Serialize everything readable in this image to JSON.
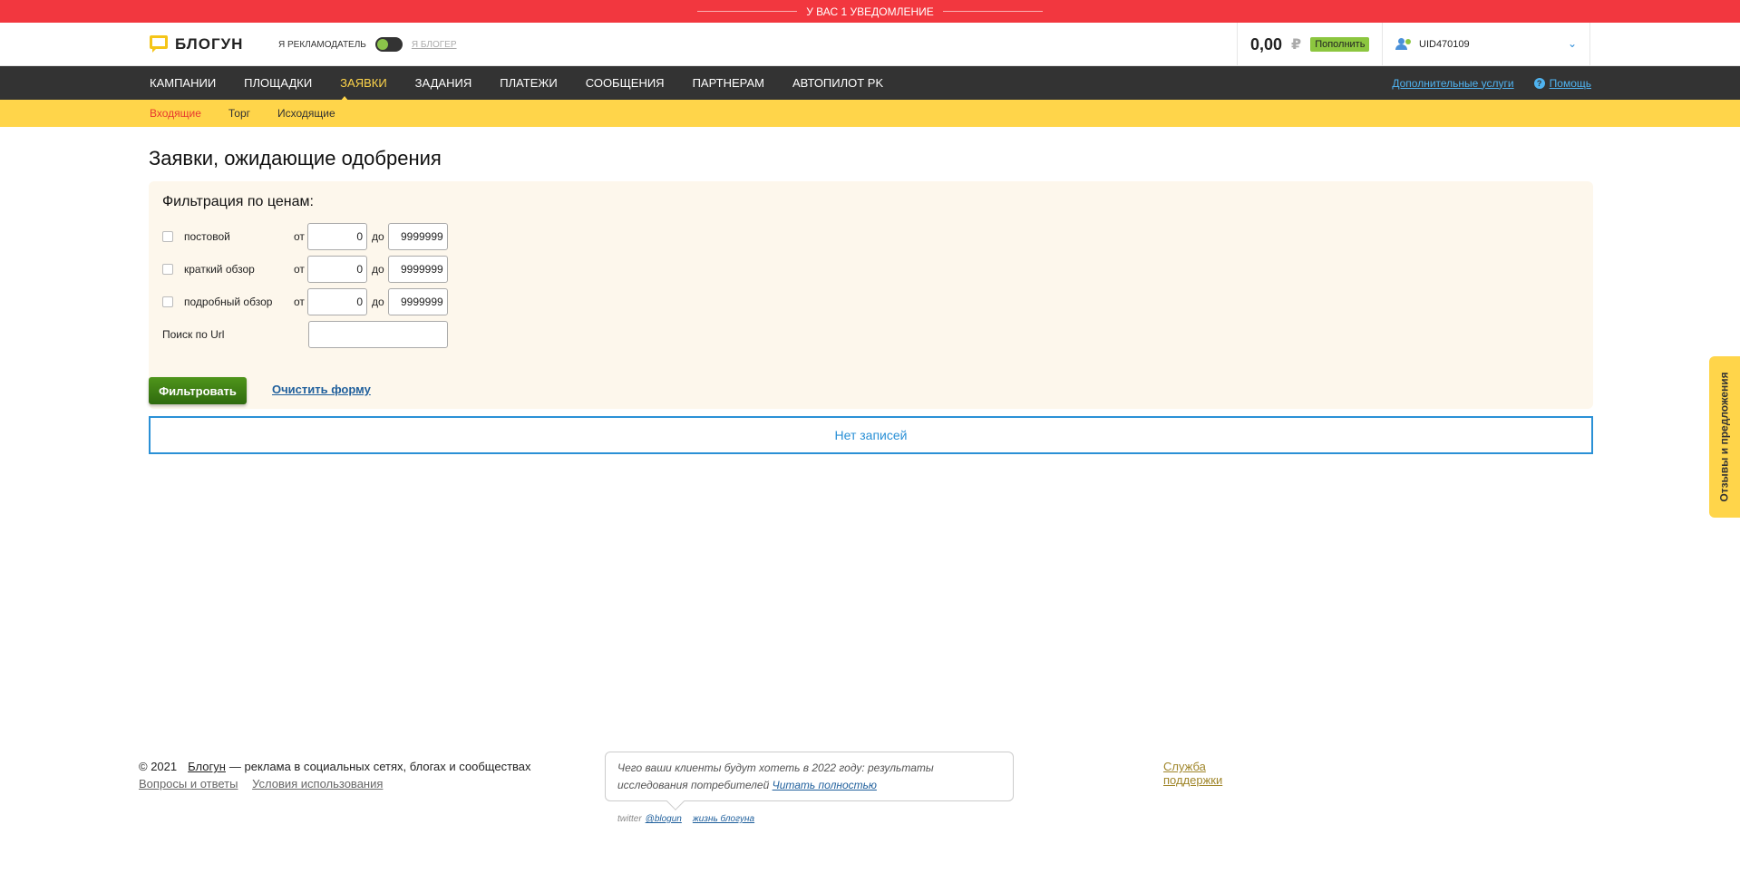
{
  "notification": {
    "text": "У ВАС 1 УВЕДОМЛЕНИЕ"
  },
  "header": {
    "logo_text": "БЛОГУН",
    "role_advertiser": "Я РЕКЛАМОДАТЕЛЬ",
    "role_blogger": "Я БЛОГЕР",
    "balance": "0,00",
    "currency": "₽",
    "topup_label": "Пополнить",
    "user_id": "UID470109"
  },
  "main_nav": {
    "items": [
      {
        "label": "КАМПАНИИ"
      },
      {
        "label": "ПЛОЩАДКИ"
      },
      {
        "label": "ЗАЯВКИ",
        "active": true
      },
      {
        "label": "ЗАДАНИЯ"
      },
      {
        "label": "ПЛАТЕЖИ"
      },
      {
        "label": "СООБЩЕНИЯ"
      },
      {
        "label": "ПАРТНЕРАМ"
      },
      {
        "label": "АВТОПИЛОТ PK"
      }
    ],
    "extra_services": "Дополнительные услуги",
    "help": "Помощь"
  },
  "sub_nav": {
    "items": [
      {
        "label": "Входящие",
        "active": true
      },
      {
        "label": "Торг"
      },
      {
        "label": "Исходящие"
      }
    ]
  },
  "page": {
    "title": "Заявки, ожидающие одобрения",
    "filter": {
      "title": "Фильтрация по ценам:",
      "from_label": "от",
      "to_label": "до",
      "rows": [
        {
          "label": "постовой",
          "checked": false,
          "from": "0",
          "to": "9999999"
        },
        {
          "label": "краткий обзор",
          "checked": false,
          "from": "0",
          "to": "9999999"
        },
        {
          "label": "подробный обзор",
          "checked": false,
          "from": "0",
          "to": "9999999"
        }
      ],
      "url_label": "Поиск по Url",
      "url_value": "",
      "filter_button": "Фильтровать",
      "clear_link": "Очистить форму"
    },
    "no_records": "Нет записей"
  },
  "feedback_tab": "Отзывы и предложения",
  "footer": {
    "copyright": "© 2021",
    "brand_link": "Блогун",
    "tagline": "— реклама в социальных сетях, блогах и сообществах",
    "faq": "Вопросы и ответы",
    "terms": "Условия использования",
    "quote_text": "Чего ваши клиенты будут хотеть в 2022 году: результаты исследования потребителей",
    "quote_link": "Читать полностью",
    "twitter_label": "twitter",
    "twitter_handle": "@blogun",
    "life_link": "жизнь блогуна",
    "support": "Служба поддержки"
  },
  "colors": {
    "notification_bg": "#f2373f",
    "nav_bg": "#333333",
    "accent_yellow": "#ffd54a",
    "filter_bg": "#fdf7ec",
    "button_green": "#3d7a15",
    "link_blue": "#2a90d6"
  }
}
